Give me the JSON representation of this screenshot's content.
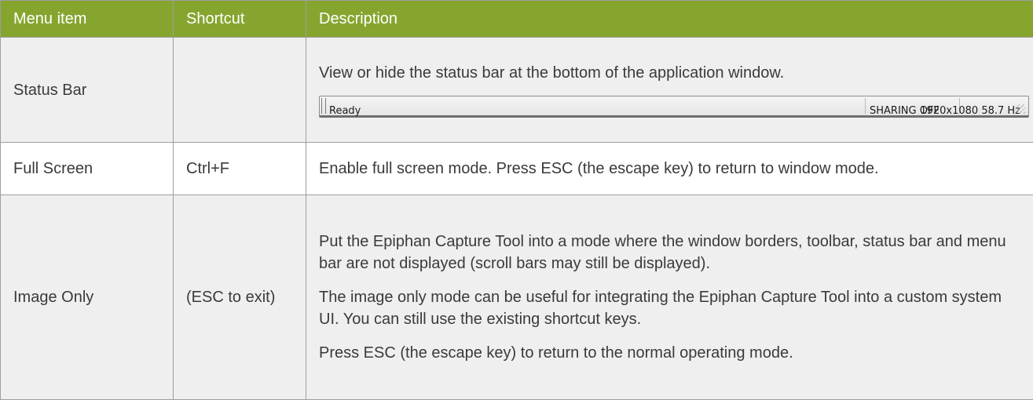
{
  "table": {
    "headers": [
      "Menu item",
      "Shortcut",
      "Description"
    ],
    "rows": [
      {
        "menu_item": "Status Bar",
        "shortcut": "",
        "description": [
          "View or hide the status bar at the bottom of the application window."
        ],
        "statusbar": {
          "ready": "Ready",
          "sharing": "SHARING OFF",
          "resolution": "1920x1080 58.7 Hz"
        }
      },
      {
        "menu_item": "Full Screen",
        "shortcut": "Ctrl+F",
        "description": [
          "Enable full screen mode. Press ESC (the escape key) to return to window mode."
        ]
      },
      {
        "menu_item": "Image Only",
        "shortcut": "(ESC to exit)",
        "description": [
          "Put the Epiphan Capture Tool into a mode where the window borders, toolbar, status bar and menu bar are not displayed (scroll bars may still be displayed).",
          "The image only mode can be useful for integrating the Epiphan Capture Tool into a custom system UI. You can still use the existing shortcut keys.",
          "Press ESC (the escape key) to return to the normal operating mode."
        ]
      }
    ]
  },
  "colors": {
    "header_bg": "#86a52f",
    "header_text": "#ffffff",
    "shaded_row": "#efefef",
    "border": "#9e9e9e"
  }
}
